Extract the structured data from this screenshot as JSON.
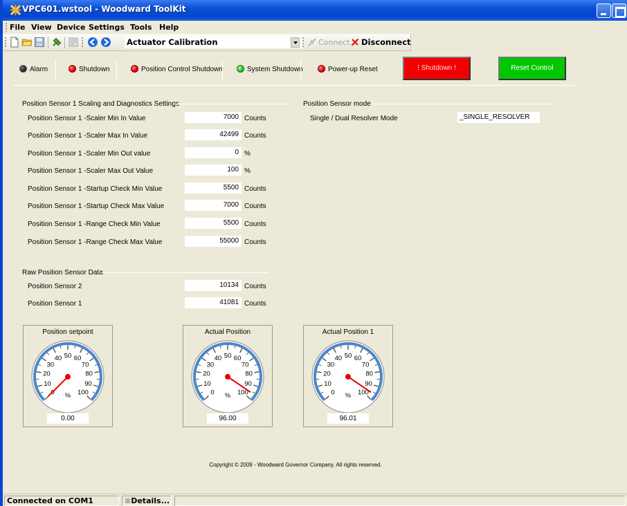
{
  "window": {
    "title": "VPC601.wstool - Woodward ToolKit"
  },
  "menu": [
    "File",
    "View",
    "Device",
    "Settings",
    "Tools",
    "Help"
  ],
  "toolbar": {
    "page": "Actuator Calibration",
    "connect_label": "Connect",
    "disconnect_label": "Disconnect"
  },
  "status": {
    "alarm": "Alarm",
    "shutdown": "Shutdown",
    "position_control_shutdown": "Position Control Shutdown",
    "system_shutdown": "System Shutdown",
    "powerup_reset": "Power-up Reset",
    "shutdown_button": "! Shutdown !",
    "reset_button": "Reset Control",
    "colors": {
      "alarm": "#222222",
      "shutdown": "#d00000",
      "position_control_shutdown": "#d00000",
      "system_shutdown": "#18b81c",
      "powerup_reset": "#d00000"
    }
  },
  "scaling": {
    "title": "Position Sensor 1 Scaling and Diagnostics Settings",
    "rows": [
      {
        "label": "Position Sensor 1 -Scaler Min In Value",
        "value": "7000",
        "unit": "Counts"
      },
      {
        "label": "Position Sensor 1 -Scaler Max In Value",
        "value": "42499",
        "unit": "Counts"
      },
      {
        "label": "Position Sensor 1 -Scaler Min Out value",
        "value": "0",
        "unit": "%"
      },
      {
        "label": "Position Sensor 1 -Scaler Max Out Value",
        "value": "100",
        "unit": "%"
      },
      {
        "label": "Position Sensor 1 -Startup Check Min Value",
        "value": "5500",
        "unit": "Counts"
      },
      {
        "label": "Position Sensor 1 -Startup Check Max Value",
        "value": "7000",
        "unit": "Counts"
      },
      {
        "label": "Position Sensor 1 -Range Check Min Value",
        "value": "5500",
        "unit": "Counts"
      },
      {
        "label": "Position Sensor 1 -Range Check Max Value",
        "value": "55000",
        "unit": "Counts"
      }
    ]
  },
  "sensor_mode": {
    "title": "Position Sensor mode",
    "label": "Single / Dual Resolver Mode",
    "value": "_SINGLE_RESOLVER"
  },
  "raw": {
    "title": "Raw Position Sensor Data",
    "rows": [
      {
        "label": "Position Sensor 2",
        "value": "10134",
        "unit": "Counts"
      },
      {
        "label": "Position Sensor 1",
        "value": "41081",
        "unit": "Counts"
      }
    ]
  },
  "gauges": [
    {
      "title": "Position setpoint",
      "value": 0,
      "display": "0.00",
      "unit": "%"
    },
    {
      "title": "Actual Position",
      "value": 96,
      "display": "96.00",
      "unit": "%"
    },
    {
      "title": "Actual Position 1",
      "value": 96.01,
      "display": "96.01",
      "unit": "%"
    }
  ],
  "gauge_scale": {
    "min": 0,
    "max": 100,
    "labels": [
      "0",
      "10",
      "20",
      "30",
      "40",
      "50",
      "60",
      "70",
      "80",
      "90",
      "100"
    ]
  },
  "footer": {
    "copyright": "Copyright © 2009 - Woodward Governor Company. All rights reserved."
  },
  "statusbar": {
    "connection": "Connected on COM1",
    "details": "Details..."
  }
}
